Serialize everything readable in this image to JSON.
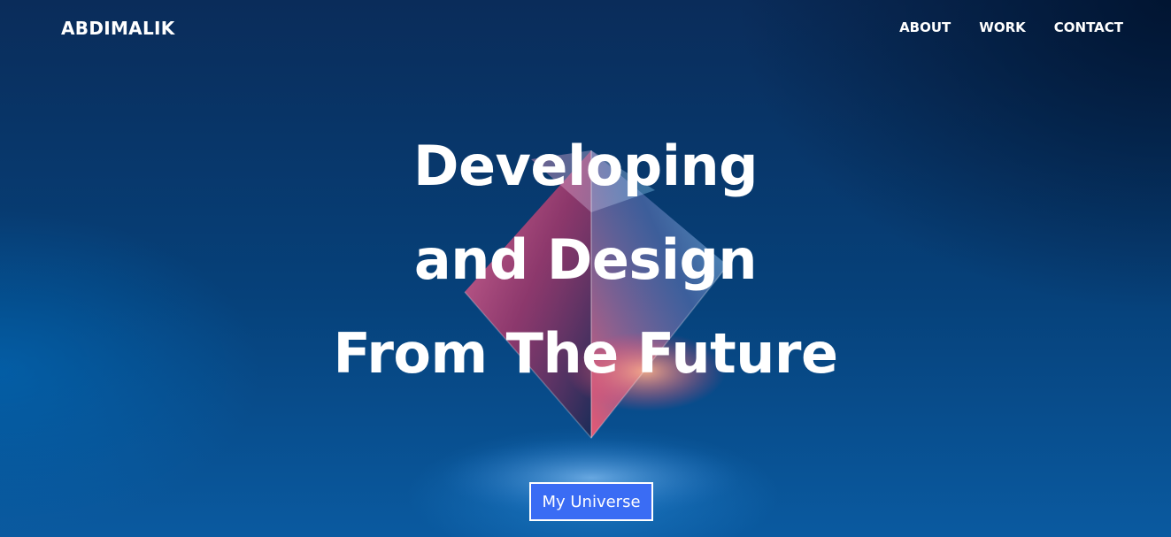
{
  "nav": {
    "logo": "ABDIMALIK",
    "links": [
      {
        "label": "ABOUT"
      },
      {
        "label": "WORK"
      },
      {
        "label": "CONTACT"
      }
    ]
  },
  "hero": {
    "headline_lines": [
      "Developing",
      "and Design",
      "From The Future"
    ],
    "cta_label": "My Universe"
  },
  "colors": {
    "background": "#0a4a88",
    "text": "#ffffff",
    "cta_background": "#3a6cf4",
    "cta_border": "#ffffff"
  }
}
